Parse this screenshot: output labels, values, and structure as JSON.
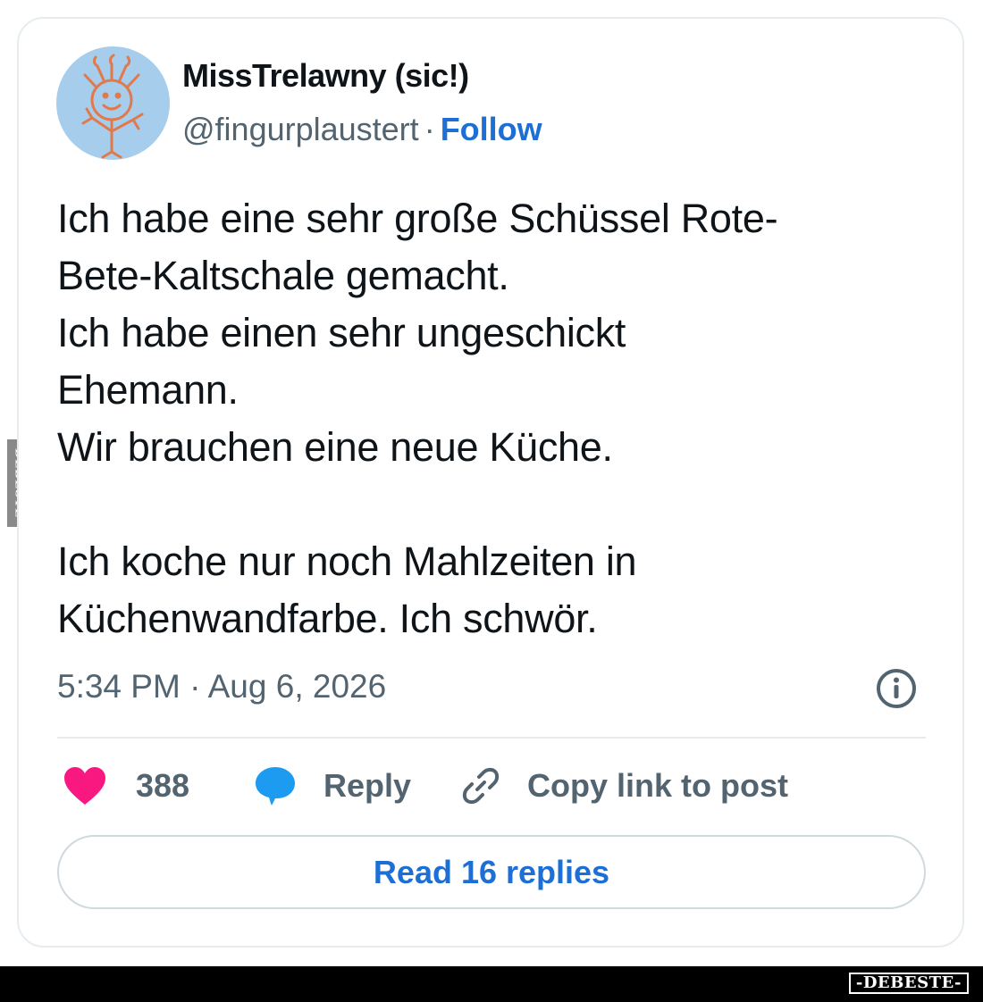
{
  "tweet": {
    "display_name": "MissTrelawny (sic!)",
    "handle": "@fingurplaustert",
    "separator": "·",
    "follow_label": "Follow",
    "text": "Ich habe eine sehr große Schüssel Rote-\nBete-Kaltschale gemacht.\nIch habe einen sehr ungeschickt\nEhemann.\nWir brauchen eine neue Küche.\n\nIch koche nur noch Mahlzeiten in\nKüchenwandfarbe. Ich schwör.",
    "timestamp": "5:34 PM · Aug 6, 2026"
  },
  "actions": {
    "like_count": "388",
    "reply_label": "Reply",
    "copy_link_label": "Copy link to post"
  },
  "read_replies_label": "Read 16 replies",
  "watermark": {
    "side_text": "DEBESTE",
    "footer_logo": "-DEBESTE-"
  },
  "colors": {
    "link_blue": "#1d6fd6",
    "like_pink": "#f91880",
    "reply_blue": "#1d9bf0",
    "secondary_text": "#536471",
    "avatar_bg": "#a6cdec"
  },
  "icons": {
    "like": "heart-icon",
    "reply": "speech-bubble-icon",
    "copy_link": "link-icon",
    "info": "info-icon"
  }
}
